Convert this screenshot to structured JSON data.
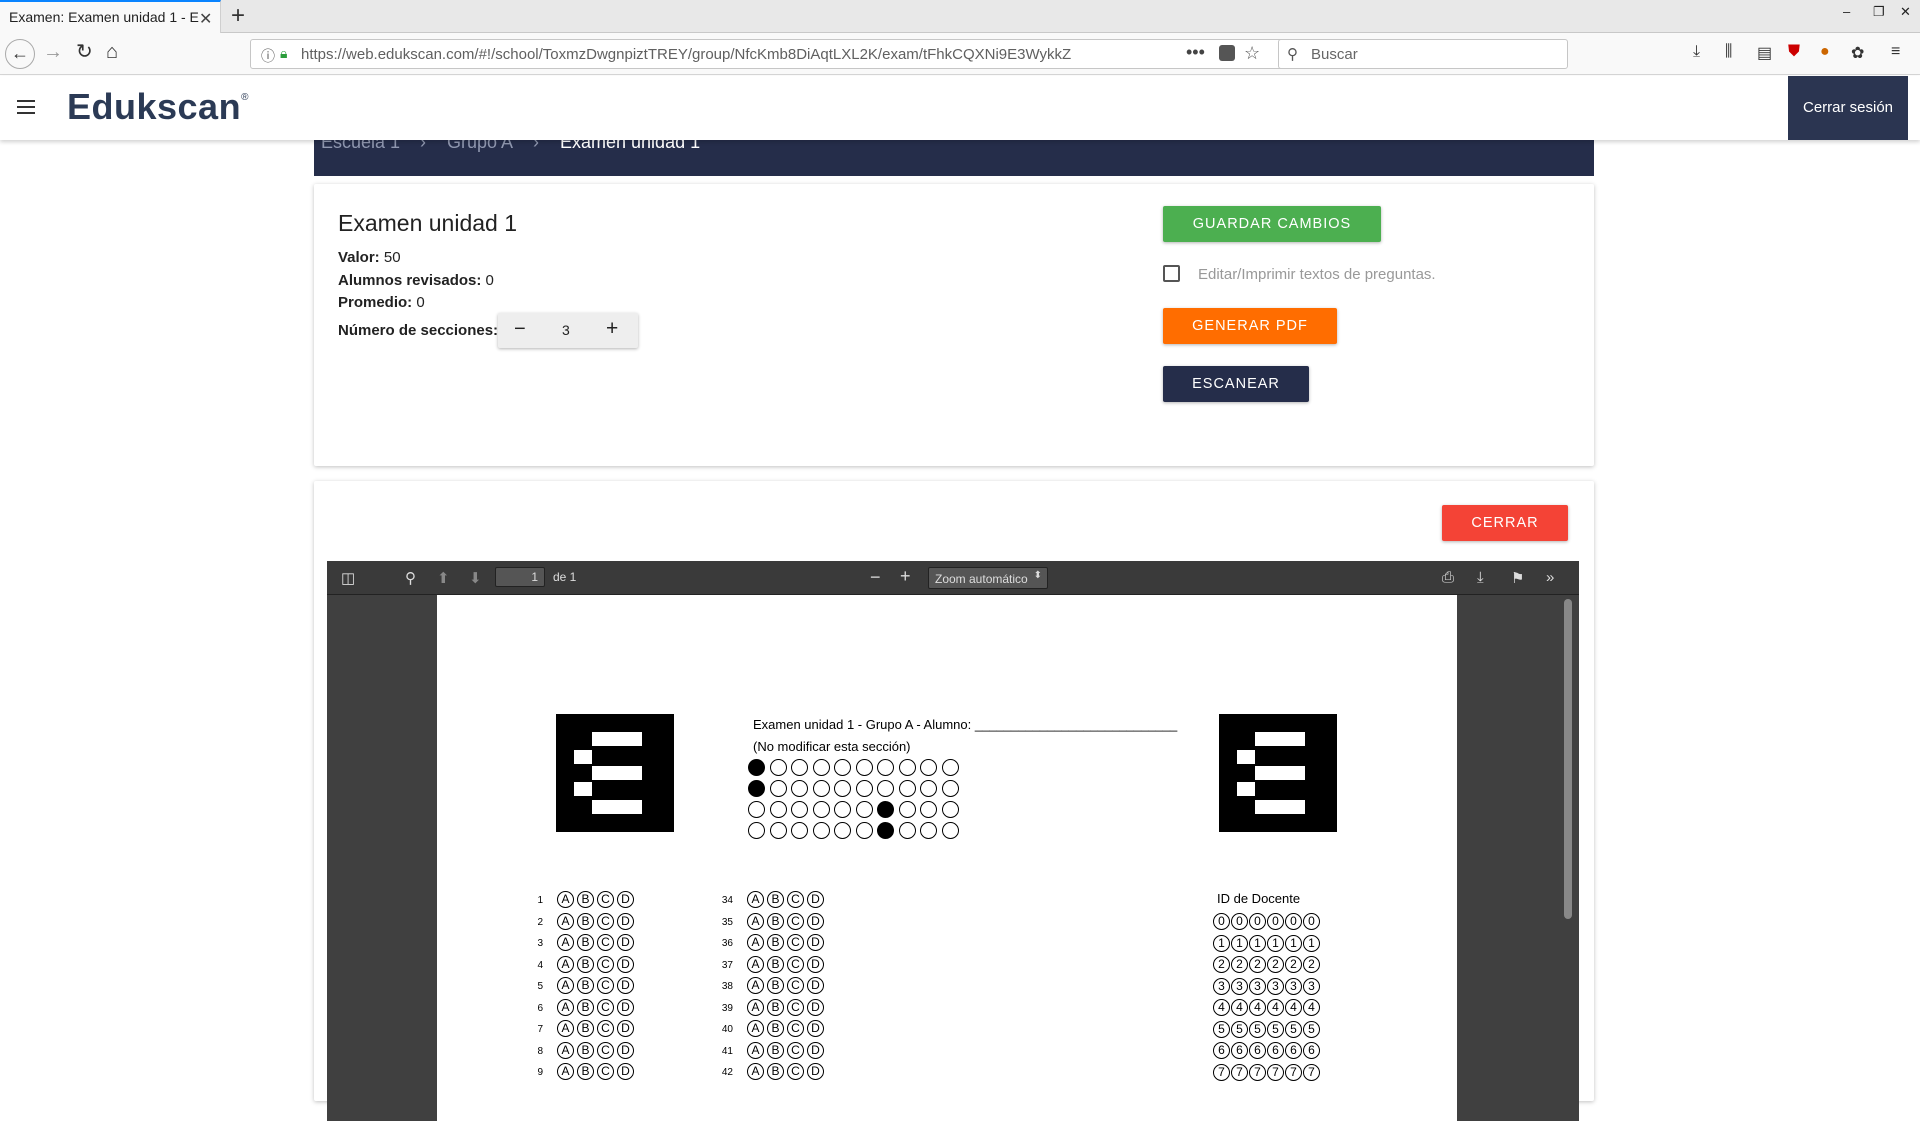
{
  "browser": {
    "tab_title": "Examen: Examen unidad 1 - E",
    "url": "https://web.edukscan.com/#!/school/ToxmzDwgnpiztTREY/group/NfcKmb8DiAqtLXL2K/exam/tFhkCQXNi9E3WykkZ",
    "search_placeholder": "Buscar",
    "minimize_glyph": "–",
    "restore_glyph": "❐",
    "close_glyph": "✕"
  },
  "app": {
    "logo": "Edukscan",
    "logo_mark": "®",
    "logout_label": "Cerrar sesión"
  },
  "breadcrumb": {
    "items": [
      "Escuela 1",
      "Grupo A",
      "Examen unidad 1"
    ],
    "separator": "›"
  },
  "exam": {
    "title": "Examen unidad 1",
    "valor_label": "Valor:",
    "valor": "50",
    "revisados_label": "Alumnos revisados:",
    "revisados": "0",
    "promedio_label": "Promedio:",
    "promedio": "0",
    "secciones_label": "Número de secciones:",
    "secciones": "3",
    "minus": "−",
    "plus": "+"
  },
  "actions": {
    "save": "GUARDAR CAMBIOS",
    "edit_texts": "Editar/Imprimir textos de preguntas.",
    "edit_texts_checked": false,
    "pdf": "GENERAR PDF",
    "scan": "ESCANEAR",
    "close": "CERRAR"
  },
  "pdf_viewer": {
    "page": "1",
    "of_label": "de 1",
    "zoom": "Zoom automático",
    "page_header": "Examen unidad 1 - Grupo A - Alumno: ____________________________",
    "page_subheader": "(No modificar esta sección)",
    "teacher_id_label": "ID de Docente",
    "options": [
      "A",
      "B",
      "C",
      "D"
    ],
    "col1_numbers": [
      "1",
      "2",
      "3",
      "4",
      "5",
      "6",
      "7",
      "8",
      "9"
    ],
    "col2_numbers": [
      "34",
      "35",
      "36",
      "37",
      "38",
      "39",
      "40",
      "41",
      "42"
    ],
    "id_digits": [
      "0",
      "1",
      "2",
      "3",
      "4",
      "5",
      "6",
      "7"
    ],
    "id_circled": [
      "⓪",
      "①",
      "②",
      "③",
      "④",
      "⑤",
      "⑥",
      "⑦"
    ],
    "id_columns": 6,
    "code_grid_filled": [
      [
        0
      ],
      [
        0
      ],
      [
        6
      ],
      [
        6
      ]
    ]
  }
}
